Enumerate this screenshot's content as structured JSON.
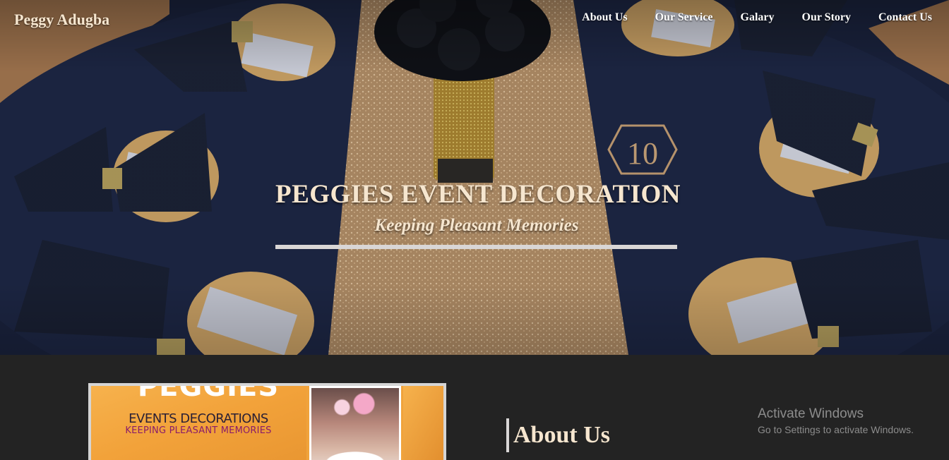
{
  "header": {
    "brand": "Peggy Adugba",
    "nav": [
      {
        "label": "About Us"
      },
      {
        "label": "Our Service"
      },
      {
        "label": "Galary"
      },
      {
        "label": "Our Story"
      },
      {
        "label": "Contact Us"
      }
    ]
  },
  "hero": {
    "title": "PEGGIES EVENT DECORATION",
    "subtitle": "Keeping Pleasant Memories",
    "table_number": "10"
  },
  "about": {
    "heading": "About Us",
    "flyer": {
      "big_text": "PEGGIES",
      "line1": "EVENTS DECORATIONS",
      "line2": "KEEPING PLEASANT MEMORIES"
    }
  },
  "watermark": {
    "title": "Activate Windows",
    "subtitle": "Go to Settings to activate Windows."
  },
  "colors": {
    "accent_cream": "#f6e6cf",
    "section_bg": "#232323",
    "tablecloth_navy": "#1b2440",
    "runner_gold": "#c9a277"
  }
}
